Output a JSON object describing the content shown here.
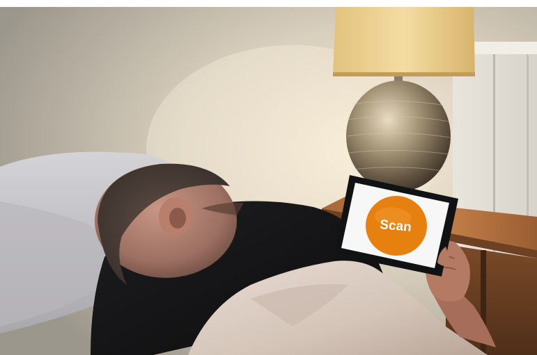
{
  "tablet": {
    "scan_button_label": "Scan"
  }
}
